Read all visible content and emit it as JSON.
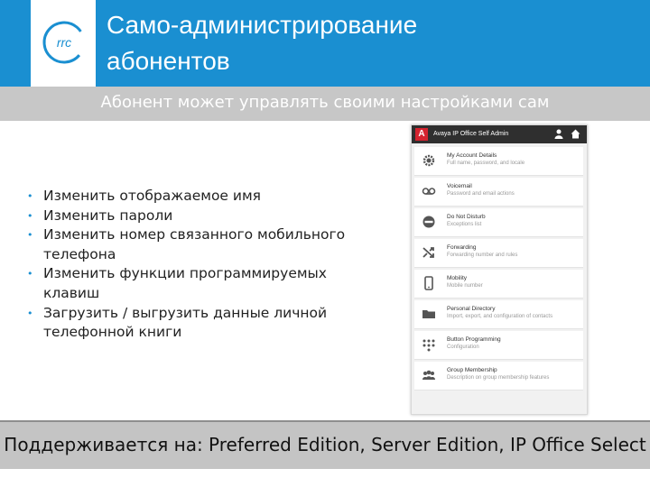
{
  "header": {
    "logo": "rrc",
    "title_line1": "Само-администрирование",
    "title_line2": "абонентов",
    "background": "#1a8fd1"
  },
  "subtitle": "Абонент может управлять своими настройками сам",
  "bullets": [
    "Изменить отображаемое имя",
    "Изменить пароли",
    "Изменить номер связанного мобильного телефона",
    "Изменить функции программируемых клавиш",
    "Загрузить / выгрузить данные личной телефонной книги"
  ],
  "app": {
    "title": "Avaya IP Office Self Admin",
    "logo_letter": "A",
    "accent": "#d5232f",
    "menu": [
      {
        "icon": "gear-icon",
        "title": "My Account Details",
        "subtitle": "Full name, password, and locale"
      },
      {
        "icon": "voicemail-icon",
        "title": "Voicemail",
        "subtitle": "Password and email actions"
      },
      {
        "icon": "do-not-disturb-icon",
        "title": "Do Not Disturb",
        "subtitle": "Exceptions list"
      },
      {
        "icon": "forwarding-icon",
        "title": "Forwarding",
        "subtitle": "Forwarding number and rules"
      },
      {
        "icon": "mobile-icon",
        "title": "Mobility",
        "subtitle": "Mobile number"
      },
      {
        "icon": "folder-icon",
        "title": "Personal Directory",
        "subtitle": "Import, export, and configuration of contacts"
      },
      {
        "icon": "keypad-icon",
        "title": "Button Programming",
        "subtitle": "Configuration"
      },
      {
        "icon": "group-icon",
        "title": "Group Membership",
        "subtitle": "Description on group membership features"
      }
    ]
  },
  "footer": "Поддерживается на: Preferred Edition, Server Edition, IP Office Select"
}
